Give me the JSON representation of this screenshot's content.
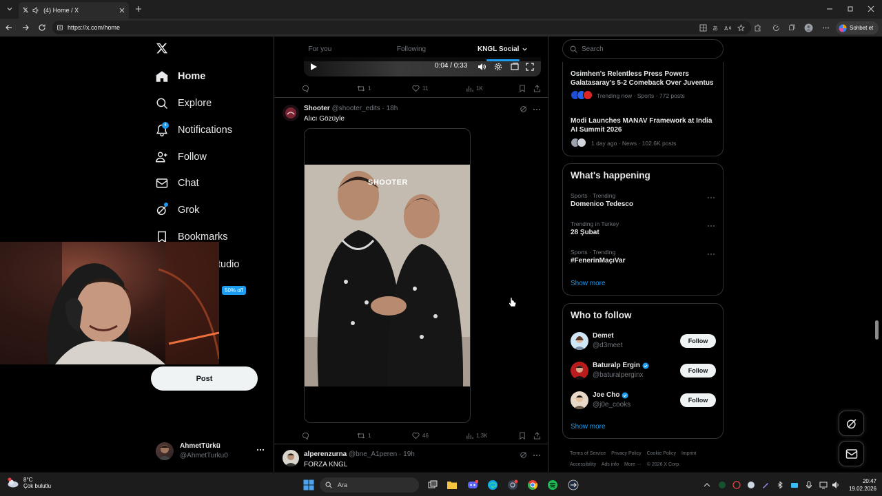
{
  "browser": {
    "tab_title": "(4) Home / X",
    "url": "https://x.com/home",
    "copilot_label": "Sohbet et"
  },
  "nav": {
    "items": [
      {
        "label": "Home",
        "icon": "home-icon"
      },
      {
        "label": "Explore",
        "icon": "search-icon"
      },
      {
        "label": "Notifications",
        "icon": "bell-icon",
        "badge": "4"
      },
      {
        "label": "Follow",
        "icon": "person-add-icon"
      },
      {
        "label": "Chat",
        "icon": "mail-icon"
      },
      {
        "label": "Grok",
        "icon": "grok-icon"
      },
      {
        "label": "Bookmarks",
        "icon": "bookmark-icon"
      }
    ],
    "studio_fragment": "tudio",
    "offer_badge": "50% off",
    "post_label": "Post",
    "account": {
      "name": "AhmetTürkü",
      "handle": "@AhmetTurku0"
    }
  },
  "feed": {
    "tabs": [
      {
        "label": "For you",
        "active": false
      },
      {
        "label": "Following",
        "active": false
      },
      {
        "label": "KNGL Social",
        "active": true
      }
    ],
    "video_time": "0:04 / 0:33",
    "first_post_stats": {
      "replies": "",
      "reposts": "1",
      "likes": "11",
      "views": "1K"
    },
    "posts": [
      {
        "name": "Shooter",
        "handle": "@shooter_edits",
        "time": "· 18h",
        "text": "Alıcı Gözüyle",
        "media_caption": "SHOOTER",
        "stats": {
          "replies": "",
          "reposts": "1",
          "likes": "46",
          "views": "1.3K"
        }
      },
      {
        "name": "alperenzurna",
        "handle": "@bne_A1peren",
        "time": "· 19h",
        "text": "FORZA KNGL"
      }
    ]
  },
  "sidebar": {
    "search_placeholder": "Search",
    "news": [
      {
        "title": "Osimhen's Relentless Press Powers Galatasaray's 5-2 Comeback Over Juventus",
        "meta": "Trending now · Sports · 772 posts"
      },
      {
        "title": "Modi Launches MANAV Framework at India AI Summit 2026",
        "meta": "1 day ago · News · 102.6K posts"
      }
    ],
    "whats_happening": {
      "title": "What's happening",
      "trends": [
        {
          "category": "Sports · Trending",
          "name": "Domenico Tedesco"
        },
        {
          "category": "Trending in Turkey",
          "name": "28 Şubat"
        },
        {
          "category": "Sports · Trending",
          "name": "#FenerinMaçıVar"
        }
      ],
      "show_more": "Show more"
    },
    "who_to_follow": {
      "title": "Who to follow",
      "users": [
        {
          "name": "Demet",
          "handle": "@d3meet",
          "verified": false
        },
        {
          "name": "Baturalp Ergin",
          "handle": "@baturalperginx",
          "verified": true
        },
        {
          "name": "Joe Cho",
          "handle": "@j0e_cooks",
          "verified": true
        }
      ],
      "follow_label": "Follow",
      "show_more": "Show more"
    },
    "footer": [
      "Terms of Service",
      "Privacy Policy",
      "Cookie Policy",
      "Imprint",
      "Accessibility",
      "Ads info",
      "More ···",
      "© 2026 X Corp."
    ]
  },
  "taskbar": {
    "weather_temp": "8°C",
    "weather_desc": "Çok bulutlu",
    "search_label": "Ara",
    "time": "20:47",
    "date": "19.02.2026"
  },
  "colors": {
    "accent": "#1d9bf0",
    "background": "#000000",
    "border": "#2f3336",
    "muted": "#71767b"
  }
}
